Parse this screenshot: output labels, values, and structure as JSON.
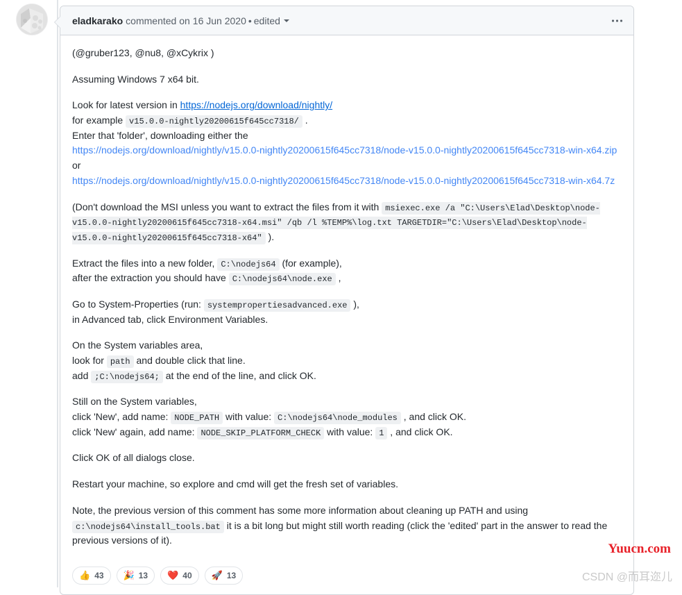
{
  "thread": {
    "avatar_alt": "eladkarako avatar"
  },
  "header": {
    "author": "eladkarako",
    "action": "commented on",
    "date": "16 Jun 2020",
    "separator": "•",
    "edited_label": "edited",
    "menu_icon": "kebab-horizontal-icon"
  },
  "body": {
    "p_mentions_open": "(",
    "mention1": "@gruber123",
    "mention_sep1": ", ",
    "mention2": "@nu8",
    "mention_sep2": ", ",
    "mention3": "@xCykrix",
    "p_mentions_close": " )",
    "p_assuming": "Assuming Windows 7 x64 bit.",
    "p_look_prefix": "Look for latest version in ",
    "look_link_text": "https://nodejs.org/download/nightly/",
    "p_forexample_prefix": "for example ",
    "forexample_code": "v15.0.0-nightly20200615f645cc7318/",
    "p_forexample_suffix": " .",
    "p_enter_folder": "Enter that 'folder', downloading either the",
    "url_zip": "https://nodejs.org/download/nightly/v15.0.0-nightly20200615f645cc7318/node-v15.0.0-nightly20200615f645cc7318-win-x64.zip",
    "or_text": "or",
    "url_7z": "https://nodejs.org/download/nightly/v15.0.0-nightly20200615f645cc7318/node-v15.0.0-nightly20200615f645cc7318-win-x64.7z",
    "p_msi_prefix": "(Don't download the MSI unless you want to extract the files from it with ",
    "msi_code": "msiexec.exe /a \"C:\\Users\\Elad\\Desktop\\node-v15.0.0-nightly20200615f645cc7318-x64.msi\" /qb /l %TEMP%\\log.txt TARGETDIR=\"C:\\Users\\Elad\\Desktop\\node-v15.0.0-nightly20200615f645cc7318-x64\"",
    "p_msi_suffix": " ).",
    "p_extract_prefix": "Extract the files into a new folder, ",
    "extract_code": "C:\\nodejs64",
    "p_extract_suffix": " (for example),",
    "p_after_extract_prefix": "after the extraction you should have ",
    "after_extract_code": "C:\\nodejs64\\node.exe",
    "p_after_extract_suffix": " ,",
    "p_sysprops_prefix": "Go to System-Properties (run: ",
    "sysprops_code": "systempropertiesadvanced.exe",
    "p_sysprops_suffix": " ),",
    "p_advanced_tab": "in Advanced tab, click Environment Variables.",
    "p_sysvars_area": "On the System variables area,",
    "p_lookfor_prefix": "look for ",
    "lookfor_code": "path",
    "p_lookfor_suffix": " and double click that line.",
    "p_add_prefix": "add ",
    "add_code": ";C:\\nodejs64;",
    "p_add_suffix": " at the end of the line, and click OK.",
    "p_still_sysvars": "Still on the System variables,",
    "p_new1_prefix": "click 'New', add name: ",
    "new1_name_code": "NODE_PATH",
    "p_new1_mid": " with value: ",
    "new1_value_code": "C:\\nodejs64\\node_modules",
    "p_new1_suffix": " , and click OK.",
    "p_new2_prefix": "click 'New' again, add name: ",
    "new2_name_code": "NODE_SKIP_PLATFORM_CHECK",
    "p_new2_mid": " with value: ",
    "new2_value_code": "1",
    "p_new2_suffix": " , and click OK.",
    "p_click_ok": "Click OK of all dialogs close.",
    "p_restart": "Restart your machine, so explore and cmd will get the fresh set of variables.",
    "p_note_prefix": "Note, the previous version of this comment has some more information about cleaning up PATH and using ",
    "note_code": "c:\\nodejs64\\install_tools.bat",
    "p_note_suffix": " it is a bit long but might still worth reading (click the 'edited' part in the answer to read the previous versions of it)."
  },
  "reactions": [
    {
      "name": "thumbs-up",
      "emoji": "👍",
      "count": "43"
    },
    {
      "name": "party-popper",
      "emoji": "🎉",
      "count": "13"
    },
    {
      "name": "heart",
      "emoji": "❤️",
      "count": "40"
    },
    {
      "name": "rocket",
      "emoji": "🚀",
      "count": "13"
    }
  ],
  "watermarks": {
    "yuucn": "Yuucn.com",
    "csdn": "CSDN @而耳迩儿"
  },
  "colors": {
    "link": "#0366d6",
    "autolink": "#4286f5",
    "header_bg": "#f6f8fa",
    "border": "#d1d5da",
    "code_bg": "#eef0f2",
    "watermark_red": "#e8222a"
  }
}
